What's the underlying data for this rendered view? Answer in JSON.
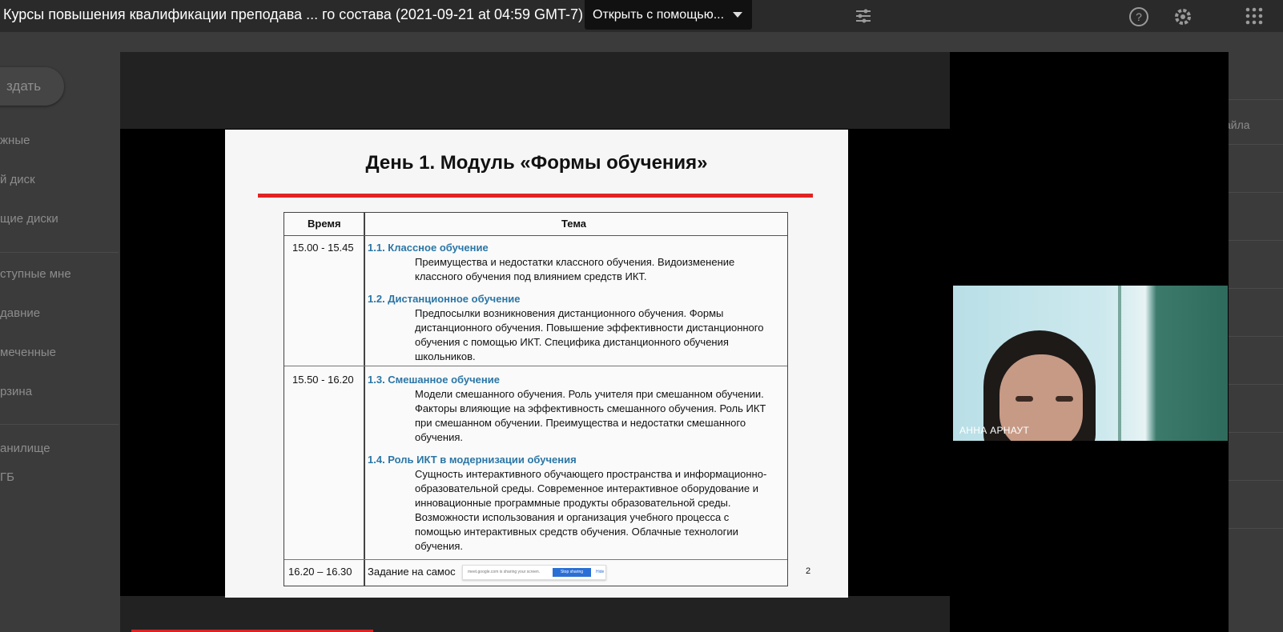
{
  "topbar": {
    "file_title": "Курсы повышения квалификации преподава ... го состава (2021-09-21 at 04:59 GMT-7)",
    "open_with_label": "Открыть с помощью...",
    "icons": [
      "tune-icon",
      "help-icon",
      "settings-icon",
      "apps-icon"
    ]
  },
  "sidebar": {
    "create_label": "здать",
    "items": [
      "жные",
      "й диск",
      "щие диски",
      "ступные мне",
      "давние",
      "меченные",
      "рзина",
      "анилище",
      "ГБ"
    ]
  },
  "right_list": {
    "partial_text": "айла"
  },
  "slide": {
    "title": "День 1. Модуль «Формы обучения»",
    "headers": {
      "time": "Время",
      "topic": "Тема"
    },
    "rows": [
      {
        "time": "15.00 - 15.45",
        "topics": [
          {
            "title": "1.1. Классное обучение",
            "desc": "Преимущества и недостатки классного обучения. Видоизменение классного обучения под влиянием средств ИКТ."
          },
          {
            "title": "1.2. Дистанционное обучение",
            "desc": "Предпосылки возникновения дистанционного обучения. Формы дистанционного обучения. Повышение эффективности дистанционного обучения с помощью ИКТ. Специфика дистанционного обучения школьников."
          }
        ]
      },
      {
        "time": "15.50 - 16.20",
        "topics": [
          {
            "title": "1.3. Смешанное обучение",
            "desc": "Модели смешанного обучения. Роль учителя при смешанном обучении. Факторы влияющие на эффективность смешанного обучения. Роль ИКТ при смешанном обучении. Преимущества и недостатки смешанного обучения."
          },
          {
            "title": "1.4. Роль ИКТ в модернизации обучения",
            "desc": "Сущность интерактивного обучающего пространства и информационно-образовательной среды. Современное интерактивное оборудование и инновационные программные продукты образовательной среды. Возможности использования и организация учебного процесса с помощью интерактивных средств обучения. Облачные технологии обучения."
          }
        ]
      },
      {
        "time": "16.20 – 16.30",
        "task": "Задание на самос"
      }
    ],
    "share_bar": {
      "text": "meet.google.com is sharing your screen.",
      "stop_label": "Stop sharing",
      "hide_label": "Hide"
    },
    "page_number": "2"
  },
  "webcam": {
    "name": "АННА АРНАУТ"
  },
  "colors": {
    "accent_red": "#e12323",
    "topic_blue": "#2b76a6"
  }
}
